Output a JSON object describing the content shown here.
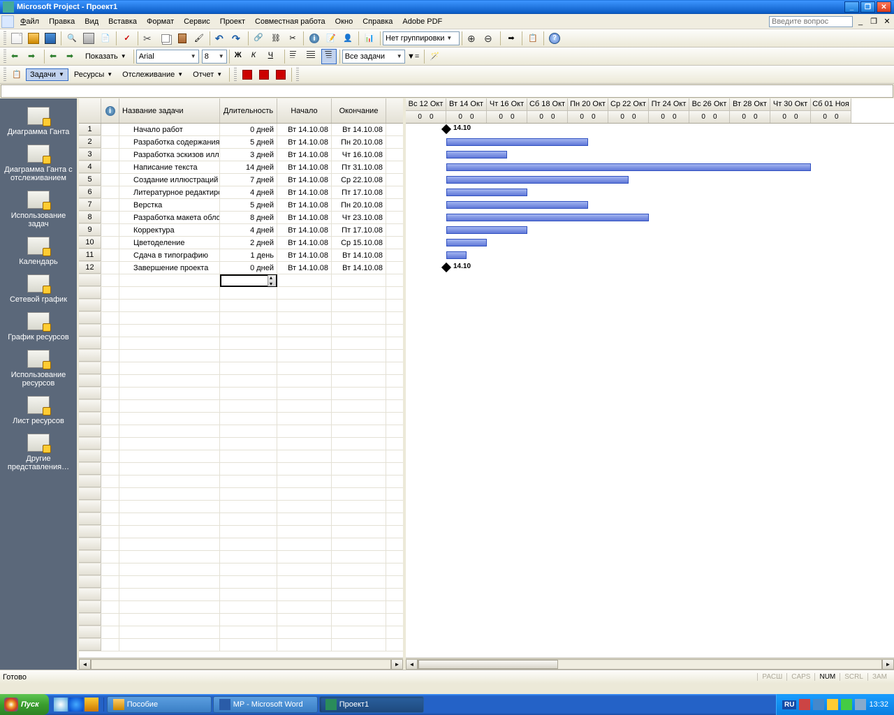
{
  "window": {
    "title": "Microsoft Project - Проект1"
  },
  "menu": {
    "file": "Файл",
    "edit": "Правка",
    "view": "Вид",
    "insert": "Вставка",
    "format": "Формат",
    "tools": "Сервис",
    "project": "Проект",
    "collab": "Совместная работа",
    "window": "Окно",
    "help": "Справка",
    "adobe": "Adobe PDF",
    "question_placeholder": "Введите вопрос"
  },
  "toolbar": {
    "nogroup": "Нет группировки",
    "show": "Показать",
    "font": "Arial",
    "size": "8",
    "alltasks": "Все задачи",
    "tasks": "Задачи",
    "resources": "Ресурсы",
    "tracking": "Отслеживание",
    "report": "Отчет"
  },
  "viewbar": [
    "Диаграмма Ганта",
    "Диаграмма Ганта с отслеживанием",
    "Использование задач",
    "Календарь",
    "Сетевой график",
    "График ресурсов",
    "Использование ресурсов",
    "Лист ресурсов",
    "Другие представления…"
  ],
  "columns": {
    "name": "Название задачи",
    "duration": "Длительность",
    "start": "Начало",
    "end": "Окончание"
  },
  "tasks": [
    {
      "n": 1,
      "name": "Начало работ",
      "dur": "0 дней",
      "start": "Вт 14.10.08",
      "end": "Вт 14.10.08",
      "s": 0,
      "len": 0
    },
    {
      "n": 2,
      "name": "Разработка содержания",
      "dur": "5 дней",
      "start": "Вт 14.10.08",
      "end": "Пн 20.10.08",
      "s": 0,
      "len": 7
    },
    {
      "n": 3,
      "name": "Разработка эскизов иллюстраций",
      "dur": "3 дней",
      "start": "Вт 14.10.08",
      "end": "Чт 16.10.08",
      "s": 0,
      "len": 3
    },
    {
      "n": 4,
      "name": "Написание текста",
      "dur": "14 дней",
      "start": "Вт 14.10.08",
      "end": "Пт 31.10.08",
      "s": 0,
      "len": 18
    },
    {
      "n": 5,
      "name": "Создание иллюстраций",
      "dur": "7 дней",
      "start": "Вт 14.10.08",
      "end": "Ср 22.10.08",
      "s": 0,
      "len": 9
    },
    {
      "n": 6,
      "name": "Литературное редактирование",
      "dur": "4 дней",
      "start": "Вт 14.10.08",
      "end": "Пт 17.10.08",
      "s": 0,
      "len": 4
    },
    {
      "n": 7,
      "name": "Верстка",
      "dur": "5 дней",
      "start": "Вт 14.10.08",
      "end": "Пн 20.10.08",
      "s": 0,
      "len": 7
    },
    {
      "n": 8,
      "name": "Разработка макета обложки",
      "dur": "8 дней",
      "start": "Вт 14.10.08",
      "end": "Чт 23.10.08",
      "s": 0,
      "len": 10
    },
    {
      "n": 9,
      "name": "Корректура",
      "dur": "4 дней",
      "start": "Вт 14.10.08",
      "end": "Пт 17.10.08",
      "s": 0,
      "len": 4
    },
    {
      "n": 10,
      "name": "Цветоделение",
      "dur": "2 дней",
      "start": "Вт 14.10.08",
      "end": "Ср 15.10.08",
      "s": 0,
      "len": 2
    },
    {
      "n": 11,
      "name": "Сдача в типографию",
      "dur": "1 день",
      "start": "Вт 14.10.08",
      "end": "Вт 14.10.08",
      "s": 0,
      "len": 1
    },
    {
      "n": 12,
      "name": "Завершение проекта",
      "dur": "0 дней",
      "start": "Вт 14.10.08",
      "end": "Вт 14.10.08",
      "s": 0,
      "len": 0
    }
  ],
  "timescale": [
    "Вс 12 Окт",
    "Вт 14 Окт",
    "Чт 16 Окт",
    "Сб 18 Окт",
    "Пн 20 Окт",
    "Ср 22 Окт",
    "Пт 24 Окт",
    "Вс 26 Окт",
    "Вт 28 Окт",
    "Чт 30 Окт",
    "Сб 01 Ноя"
  ],
  "milestone_label": "14.10",
  "status": {
    "ready": "Готово",
    "caps": "CAPS",
    "num": "NUM",
    "scrl": "SCRL",
    "ins": "ЗАМ",
    "ext": "РАСШ"
  },
  "taskbar": {
    "start": "Пуск",
    "t1": "Пособие",
    "t2": "MP - Microsoft Word",
    "t3": "Проект1",
    "lang": "RU",
    "clock": "13:32"
  }
}
